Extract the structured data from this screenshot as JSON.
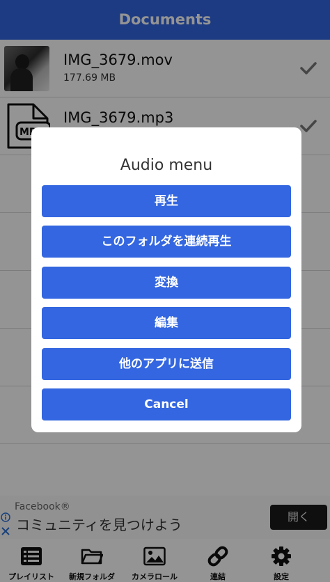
{
  "header": {
    "title": "Documents"
  },
  "files": [
    {
      "name": "IMG_3679.mov",
      "size": "177.69 MB",
      "icon": "video-thumbnail",
      "checked": true
    },
    {
      "name": "IMG_3679.mp3",
      "size": "",
      "icon": "audio-file-icon",
      "file_badge": "MP3",
      "checked": true
    }
  ],
  "modal": {
    "title": "Audio menu",
    "buttons": [
      "再生",
      "このフォルダを連続再生",
      "変換",
      "編集",
      "他のアプリに送信",
      "Cancel"
    ]
  },
  "ad": {
    "source": "Facebook®",
    "text": "コミュニティを見つけよう",
    "button": "開く"
  },
  "tabs": [
    {
      "label": "プレイリスト",
      "icon": "playlist-icon"
    },
    {
      "label": "新規フォルダ",
      "icon": "folder-icon"
    },
    {
      "label": "カメラロール",
      "icon": "image-icon"
    },
    {
      "label": "連結",
      "icon": "link-icon"
    },
    {
      "label": "設定",
      "icon": "gear-icon"
    }
  ],
  "colors": {
    "accent": "#3366e0",
    "overlay": "#000000"
  }
}
